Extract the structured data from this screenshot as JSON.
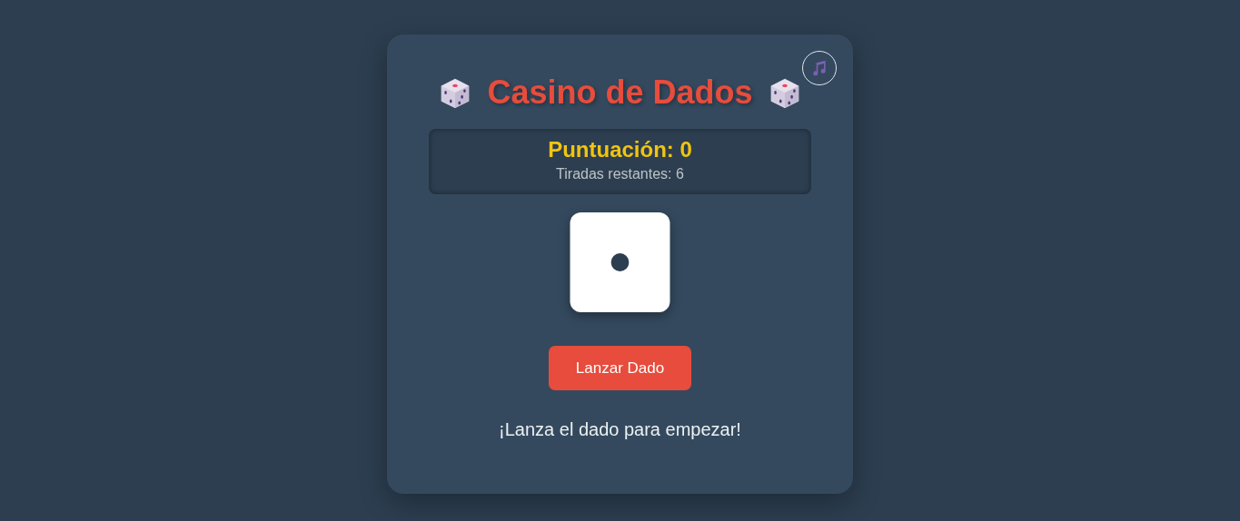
{
  "title": "Casino de Dados",
  "score": {
    "label": "Puntuación: 0",
    "rolls_left": "Tiradas restantes: 6"
  },
  "roll_button": "Lanzar Dado",
  "message": "¡Lanza el dado para empezar!"
}
